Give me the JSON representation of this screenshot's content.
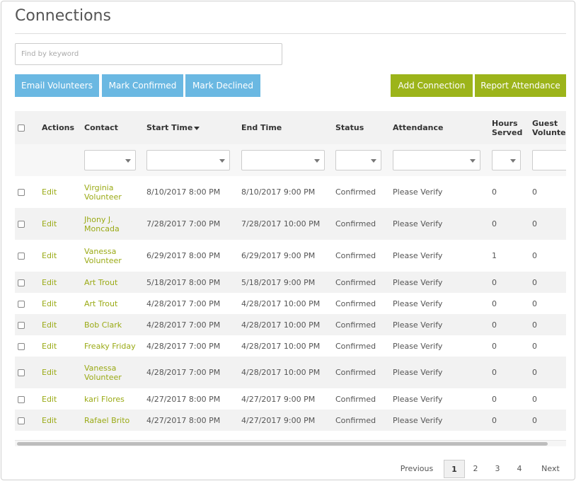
{
  "page": {
    "title": "Connections"
  },
  "search": {
    "placeholder": "Find by keyword"
  },
  "toolbar": {
    "email_volunteers": "Email Volunteers",
    "mark_confirmed": "Mark Confirmed",
    "mark_declined": "Mark Declined",
    "add_connection": "Add Connection",
    "report_attendance": "Report Attendance"
  },
  "table": {
    "headers": {
      "actions": "Actions",
      "contact": "Contact",
      "start_time": "Start Time",
      "end_time": "End Time",
      "status": "Status",
      "attendance": "Attendance",
      "hours_served_1": "Hours",
      "hours_served_2": "Served",
      "guest_volunteers_1": "Guest",
      "guest_volunteers_2": "Volunteers"
    },
    "rows": [
      {
        "action": "Edit",
        "contact_1": "Virginia",
        "contact_2": "Volunteer",
        "start": "8/10/2017 8:00 PM",
        "end": "8/10/2017 9:00 PM",
        "status": "Confirmed",
        "attendance": "Please Verify",
        "hours": "0",
        "guests": "0"
      },
      {
        "action": "Edit",
        "contact_1": "Jhony J.",
        "contact_2": "Moncada",
        "start": "7/28/2017 7:00 PM",
        "end": "7/28/2017 10:00 PM",
        "status": "Confirmed",
        "attendance": "Please Verify",
        "hours": "0",
        "guests": "0"
      },
      {
        "action": "Edit",
        "contact_1": "Vanessa",
        "contact_2": "Volunteer",
        "start": "6/29/2017 8:00 PM",
        "end": "6/29/2017 9:00 PM",
        "status": "Confirmed",
        "attendance": "Please Verify",
        "hours": "1",
        "guests": "0"
      },
      {
        "action": "Edit",
        "contact_1": "Art Trout",
        "contact_2": "",
        "start": "5/18/2017 8:00 PM",
        "end": "5/18/2017 9:00 PM",
        "status": "Confirmed",
        "attendance": "Please Verify",
        "hours": "0",
        "guests": "0"
      },
      {
        "action": "Edit",
        "contact_1": "Art Trout",
        "contact_2": "",
        "start": "4/28/2017 7:00 PM",
        "end": "4/28/2017 10:00 PM",
        "status": "Confirmed",
        "attendance": "Please Verify",
        "hours": "0",
        "guests": "0"
      },
      {
        "action": "Edit",
        "contact_1": "Bob Clark",
        "contact_2": "",
        "start": "4/28/2017 7:00 PM",
        "end": "4/28/2017 10:00 PM",
        "status": "Confirmed",
        "attendance": "Please Verify",
        "hours": "0",
        "guests": "0"
      },
      {
        "action": "Edit",
        "contact_1": "Freaky Friday",
        "contact_2": "",
        "start": "4/28/2017 7:00 PM",
        "end": "4/28/2017 10:00 PM",
        "status": "Confirmed",
        "attendance": "Please Verify",
        "hours": "0",
        "guests": "0"
      },
      {
        "action": "Edit",
        "contact_1": "Vanessa",
        "contact_2": "Volunteer",
        "start": "4/28/2017 7:00 PM",
        "end": "4/28/2017 10:00 PM",
        "status": "Confirmed",
        "attendance": "Please Verify",
        "hours": "0",
        "guests": "0"
      },
      {
        "action": "Edit",
        "contact_1": "kari Flores",
        "contact_2": "",
        "start": "4/27/2017 8:00 PM",
        "end": "4/27/2017 9:00 PM",
        "status": "Confirmed",
        "attendance": "Please Verify",
        "hours": "0",
        "guests": "0"
      },
      {
        "action": "Edit",
        "contact_1": "Rafael Brito",
        "contact_2": "",
        "start": "4/27/2017 8:00 PM",
        "end": "4/27/2017 9:00 PM",
        "status": "Confirmed",
        "attendance": "Please Verify",
        "hours": "0",
        "guests": "0"
      }
    ]
  },
  "pagination": {
    "previous": "Previous",
    "pages": [
      "1",
      "2",
      "3",
      "4"
    ],
    "next": "Next",
    "current": "1"
  },
  "colors": {
    "blue_button": "#6ab8e2",
    "olive_button": "#9cb41a",
    "link": "#9aaa15"
  }
}
